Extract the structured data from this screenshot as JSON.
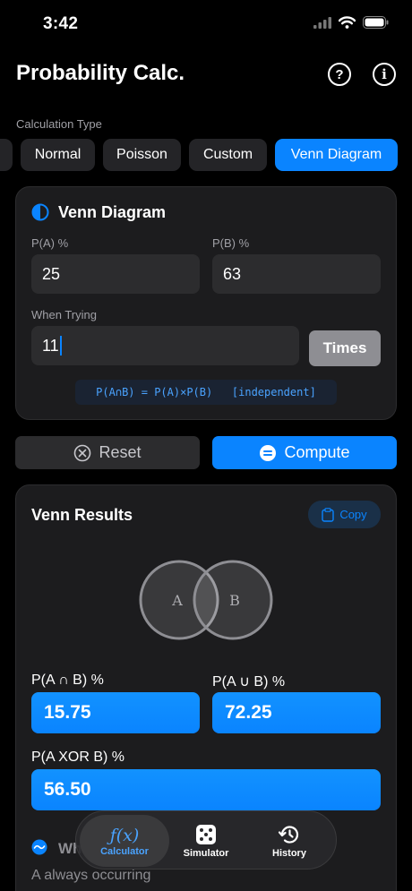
{
  "status": {
    "time": "3:42"
  },
  "nav": {
    "title": "Probability Calc.",
    "help_icon": "question-circle-icon",
    "info_icon": "info-circle-icon"
  },
  "calc_type": {
    "label": "Calculation Type",
    "options": [
      "Normal",
      "Poisson",
      "Custom",
      "Venn Diagram"
    ],
    "selected": "Venn Diagram"
  },
  "venn_input": {
    "title": "Venn Diagram",
    "pa_label": "P(A) %",
    "pa_value": "25",
    "pb_label": "P(B) %",
    "pb_value": "63",
    "trying_label": "When Trying",
    "trying_value": "11",
    "times_label": "Times",
    "formula": "P(A∩B) = P(A)×P(B)   [independent]"
  },
  "actions": {
    "reset": "Reset",
    "compute": "Compute"
  },
  "results": {
    "title": "Venn Results",
    "copy": "Copy",
    "circle_a": "A",
    "circle_b": "B",
    "intersection_label": "P(A ∩ B) %",
    "intersection_value": "15.75",
    "union_label": "P(A ∪ B) %",
    "union_value": "72.25",
    "xor_label": "P(A XOR B) %",
    "xor_value": "56.50",
    "peek_title": "Wh",
    "peek_text": "A always occurring"
  },
  "tabbar": {
    "calculator": "Calculator",
    "simulator": "Simulator",
    "history": "History",
    "calculator_glyph": "ƒ(x)"
  },
  "colors": {
    "accent": "#0a84ff",
    "card": "#1c1c1e",
    "field": "#2c2c2e"
  }
}
